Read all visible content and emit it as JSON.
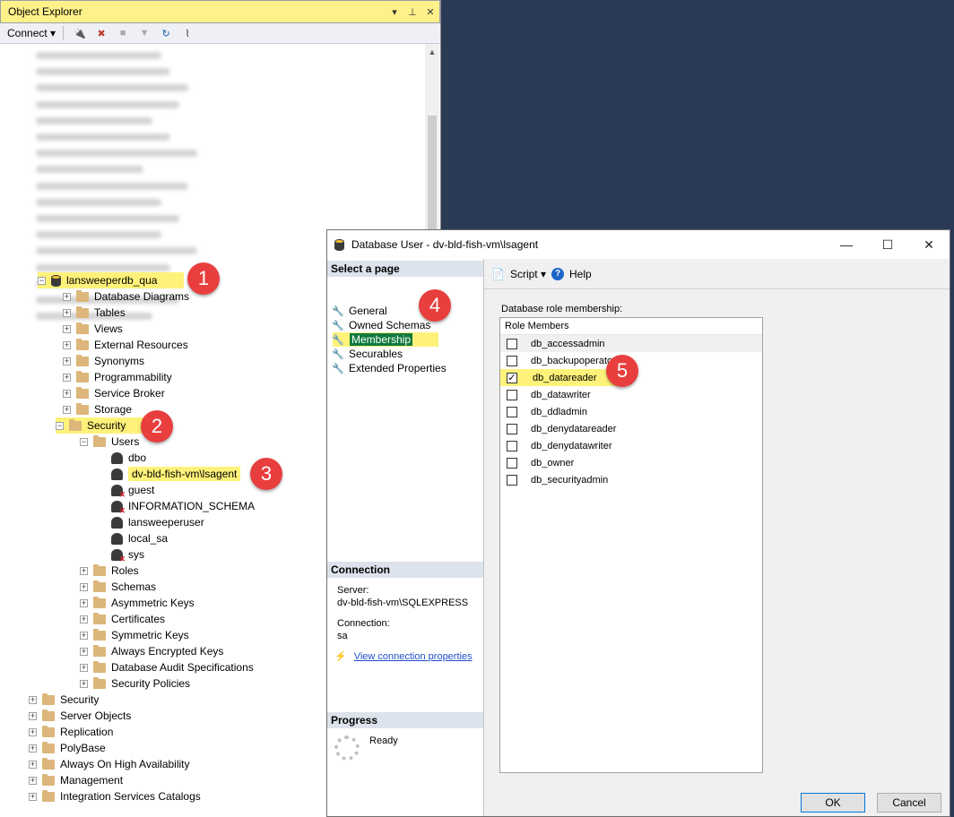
{
  "oe": {
    "title": "Object Explorer",
    "connect_label": "Connect",
    "title_icons": [
      "chevron-down-icon",
      "pin-icon",
      "close-icon"
    ],
    "tree": {
      "db": "lansweeperdb_qua",
      "db_children": [
        "Database Diagrams",
        "Tables",
        "Views",
        "External Resources",
        "Synonyms",
        "Programmability",
        "Service Broker",
        "Storage"
      ],
      "security": "Security",
      "users": "Users",
      "user_list": [
        "dbo",
        "dv-bld-fish-vm\\lsagent",
        "guest",
        "INFORMATION_SCHEMA",
        "lansweeperuser",
        "local_sa",
        "sys"
      ],
      "security_children": [
        "Roles",
        "Schemas",
        "Asymmetric Keys",
        "Certificates",
        "Symmetric Keys",
        "Always Encrypted Keys",
        "Database Audit Specifications",
        "Security Policies"
      ],
      "server_children": [
        "Security",
        "Server Objects",
        "Replication",
        "PolyBase",
        "Always On High Availability",
        "Management",
        "Integration Services Catalogs"
      ]
    }
  },
  "badges": [
    "1",
    "2",
    "3",
    "4",
    "5"
  ],
  "dialog": {
    "title": "Database User - dv-bld-fish-vm\\lsagent",
    "select_page": "Select a page",
    "pages": [
      "General",
      "Owned Schemas",
      "Membership",
      "Securables",
      "Extended Properties"
    ],
    "connection_hdr": "Connection",
    "server_label": "Server:",
    "server_value": "dv-bld-fish-vm\\SQLEXPRESS",
    "connection_label": "Connection:",
    "connection_value": "sa",
    "view_conn": "View connection properties",
    "progress_hdr": "Progress",
    "progress_status": "Ready",
    "script_label": "Script",
    "help_label": "Help",
    "role_membership_label": "Database role membership:",
    "role_header": "Role Members",
    "roles": [
      {
        "name": "db_accessadmin",
        "checked": false
      },
      {
        "name": "db_backupoperator",
        "checked": false
      },
      {
        "name": "db_datareader",
        "checked": true
      },
      {
        "name": "db_datawriter",
        "checked": false
      },
      {
        "name": "db_ddladmin",
        "checked": false
      },
      {
        "name": "db_denydatareader",
        "checked": false
      },
      {
        "name": "db_denydatawriter",
        "checked": false
      },
      {
        "name": "db_owner",
        "checked": false
      },
      {
        "name": "db_securityadmin",
        "checked": false
      }
    ],
    "ok": "OK",
    "cancel": "Cancel"
  }
}
